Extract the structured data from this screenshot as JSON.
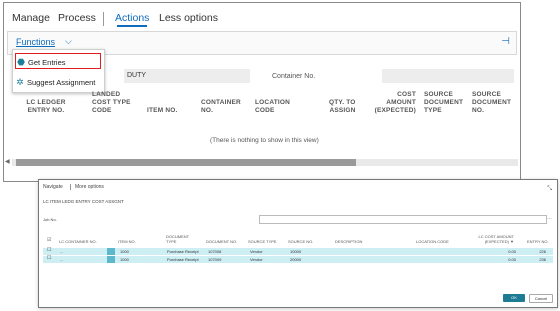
{
  "tabs": [
    "Manage",
    "Process",
    "Actions",
    "Less options"
  ],
  "functions_label": "Functions",
  "menu": {
    "get_entries": "Get Entries",
    "suggest_assignment": "Suggest Assignment"
  },
  "form": {
    "duty_value": "DUTY",
    "container_no_label": "Container No."
  },
  "columns": [
    "LC LEDGER\nENTRY NO.",
    "LANDED\nCOST TYPE\nCODE",
    "ITEM NO.",
    "CONTAINER\nNO.",
    "LOCATION\nCODE",
    "QTY. TO\nASSIGN",
    "COST\nAMOUNT\n(EXPECTED)",
    "SOURCE\nDOCUMENT\nTYPE",
    "SOURCE\nDOCUMENT\nNO."
  ],
  "empty_text": "(There is nothing to show in this view)",
  "dialog": {
    "tabs": [
      "Navigate",
      "More options"
    ],
    "title": "LC ITEM LEDG ENTRY COST ASSGNT",
    "job_no_label": "Job No.",
    "columns": [
      "LC CONTAINER NO.",
      "ITEM NO.",
      "DOCUMENT\nTYPE",
      "DOCUMENT NO.",
      "SOURCE TYPE",
      "SOURCE NO.",
      "DESCRIPTION",
      "LOCATION CODE",
      "LC COST AMOUNT\n(EXPECTED) ▼",
      "ENTRY NO."
    ],
    "rows": [
      {
        "item": "1000",
        "doc_type": "Purchase Receipt",
        "doc_no": "107008",
        "source_type": "Vendor",
        "source_no": "10000",
        "amount": "0.00",
        "entry": "226"
      },
      {
        "item": "1000",
        "doc_type": "Purchase Receipt",
        "doc_no": "107009",
        "source_type": "Vendor",
        "source_no": "20000",
        "amount": "0.00",
        "entry": "236"
      }
    ],
    "ok": "OK",
    "cancel": "Cancel"
  }
}
